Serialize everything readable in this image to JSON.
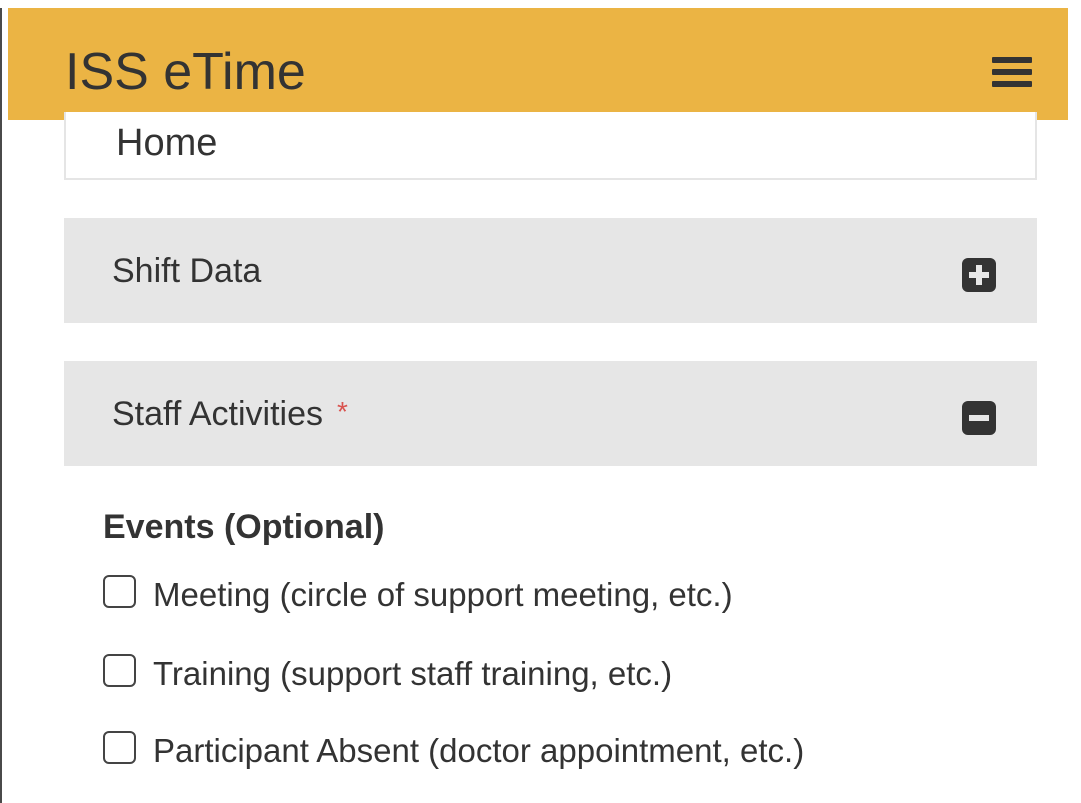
{
  "header": {
    "title": "ISS eTime",
    "menu_icon": "hamburger-menu-icon",
    "color": "#ebb444"
  },
  "home": {
    "label": "Home"
  },
  "panels": [
    {
      "label": "Shift Data",
      "icon": "plus-square-icon",
      "expanded": false
    },
    {
      "label": "Staff Activities",
      "required_marker": "*",
      "icon": "minus-square-icon",
      "expanded": true
    }
  ],
  "events": {
    "heading": "Events (Optional)",
    "options": [
      {
        "label": "Meeting (circle of support meeting, etc.)",
        "checked": false
      },
      {
        "label": "Training (support staff training, etc.)",
        "checked": false
      },
      {
        "label": "Participant Absent (doctor appointment, etc.)",
        "checked": false
      }
    ]
  },
  "colors": {
    "accent": "#ebb444",
    "required": "#d9534f",
    "panel_bg": "#e6e6e6"
  }
}
